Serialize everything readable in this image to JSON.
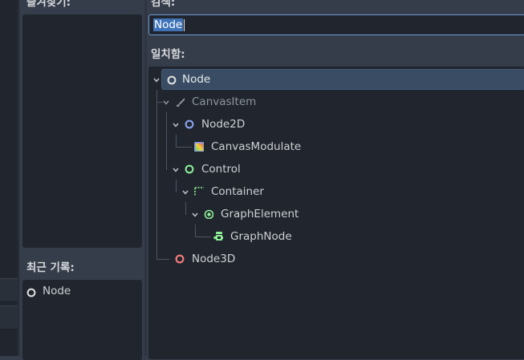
{
  "dialog": {
    "favorites_label": "즐겨찾기:",
    "search_label": "검색:",
    "search_value": "Node",
    "matches_label": "일치함:",
    "recent_label": "최근 기록:",
    "recent_items": [
      {
        "label": "Node",
        "icon": "node-circle-icon"
      }
    ]
  },
  "tree": [
    {
      "label": "Node",
      "icon": "node-circle-icon",
      "icon_color": "#e0e0e0",
      "depth": 0,
      "expanded": true,
      "selected": true
    },
    {
      "label": "CanvasItem",
      "icon": "brush-icon",
      "icon_color": "#8e959e",
      "depth": 1,
      "expanded": true,
      "dimmed": true
    },
    {
      "label": "Node2D",
      "icon": "node-circle-icon",
      "icon_color": "#8da5f3",
      "depth": 2,
      "expanded": true
    },
    {
      "label": "CanvasModulate",
      "icon": "gradient-square-icon",
      "icon_color": "#8da5f3",
      "depth": 3
    },
    {
      "label": "Control",
      "icon": "node-circle-icon",
      "icon_color": "#8eef97",
      "depth": 2,
      "expanded": true
    },
    {
      "label": "Container",
      "icon": "dotted-square-icon",
      "icon_color": "#8eef97",
      "depth": 3,
      "expanded": true
    },
    {
      "label": "GraphElement",
      "icon": "target-circle-icon",
      "icon_color": "#8eef97",
      "depth": 4,
      "expanded": true
    },
    {
      "label": "GraphNode",
      "icon": "graph-node-icon",
      "icon_color": "#8eef97",
      "depth": 5
    },
    {
      "label": "Node3D",
      "icon": "node-circle-icon",
      "icon_color": "#fc7f7f",
      "depth": 1
    }
  ],
  "colors": {
    "accent": "#6a9bd3",
    "selection": "#394c63",
    "panel": "#21262e",
    "background": "#363d4a"
  }
}
